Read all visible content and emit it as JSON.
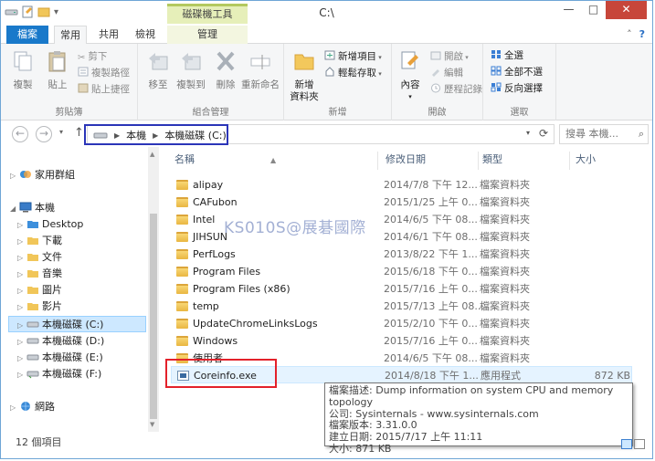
{
  "window": {
    "title": "C:\\",
    "minimize_glyph": "—",
    "maximize_glyph": "□",
    "close_glyph": "✕",
    "qat_dropdown": "▾"
  },
  "ribbon_tabs": {
    "file": "檔案",
    "home": "常用",
    "share": "共用",
    "view": "檢視",
    "context_header": "磁碟機工具",
    "manage": "管理",
    "collapse_glyph": "˄",
    "help_glyph": "?"
  },
  "ribbon": {
    "clipboard": {
      "label": "剪貼簿",
      "copy": "複製",
      "paste": "貼上",
      "cut": "剪下",
      "copy_path": "複製路徑",
      "paste_shortcut": "貼上捷徑"
    },
    "organize": {
      "label": "組合管理",
      "move_to": "移至",
      "copy_to": "複製到",
      "delete": "刪除",
      "rename": "重新命名"
    },
    "new": {
      "label": "新增",
      "new_folder": "新增\n資料夾",
      "new_item": "新增項目",
      "easy_access": "輕鬆存取"
    },
    "open": {
      "label": "開啟",
      "properties": "內容",
      "open": "開啟",
      "edit": "編輯",
      "history": "歷程記錄"
    },
    "select": {
      "label": "選取",
      "select_all": "全選",
      "select_none": "全部不選",
      "invert": "反向選擇"
    }
  },
  "addressbar": {
    "back_glyph": "←",
    "forward_glyph": "→",
    "recent_glyph": "▾",
    "up_glyph": "↑",
    "crumbs": [
      "本機",
      "本機磁碟 (C:)"
    ],
    "crumb_sep": "▶",
    "dropdown_glyph": "▾",
    "refresh_glyph": "⟳",
    "search_placeholder": "搜尋 本機...",
    "search_glyph": "⌕"
  },
  "nav": {
    "arrow_collapsed": "▷",
    "arrow_expanded": "◢",
    "items": [
      {
        "label": "家用群組"
      },
      {
        "label": "本機"
      },
      {
        "label": "Desktop"
      },
      {
        "label": "下載"
      },
      {
        "label": "文件"
      },
      {
        "label": "音樂"
      },
      {
        "label": "圖片"
      },
      {
        "label": "影片"
      },
      {
        "label": "本機磁碟 (C:)"
      },
      {
        "label": "本機磁碟 (D:)"
      },
      {
        "label": "本機磁碟 (E:)"
      },
      {
        "label": "本機磁碟 (F:)"
      },
      {
        "label": "網路"
      }
    ],
    "scroll_up": "▲",
    "scroll_down": "▼"
  },
  "filelist": {
    "columns": {
      "name": "名稱",
      "date": "修改日期",
      "type": "類型",
      "size": "大小",
      "sort_glyph": "▲"
    },
    "rows": [
      {
        "name": "alipay",
        "date": "2014/7/8 下午 12...",
        "type": "檔案資料夾",
        "size": ""
      },
      {
        "name": "CAFubon",
        "date": "2015/1/25 上午 0...",
        "type": "檔案資料夾",
        "size": ""
      },
      {
        "name": "Intel",
        "date": "2014/6/5 下午 08...",
        "type": "檔案資料夾",
        "size": ""
      },
      {
        "name": "JIHSUN",
        "date": "2014/6/1 下午 08...",
        "type": "檔案資料夾",
        "size": ""
      },
      {
        "name": "PerfLogs",
        "date": "2013/8/22 下午 1...",
        "type": "檔案資料夾",
        "size": ""
      },
      {
        "name": "Program Files",
        "date": "2015/6/18 下午 0...",
        "type": "檔案資料夾",
        "size": ""
      },
      {
        "name": "Program Files (x86)",
        "date": "2015/7/16 上午 0...",
        "type": "檔案資料夾",
        "size": ""
      },
      {
        "name": "temp",
        "date": "2015/7/13 上午 08...",
        "type": "檔案資料夾",
        "size": ""
      },
      {
        "name": "UpdateChromeLinksLogs",
        "date": "2015/2/10 下午 0...",
        "type": "檔案資料夾",
        "size": ""
      },
      {
        "name": "Windows",
        "date": "2015/7/16 上午 0...",
        "type": "檔案資料夾",
        "size": ""
      },
      {
        "name": "使用者",
        "date": "2014/6/5 下午 08...",
        "type": "檔案資料夾",
        "size": ""
      },
      {
        "name": "Coreinfo.exe",
        "date": "2014/8/18 下午 1...",
        "type": "應用程式",
        "size": "872 KB"
      }
    ]
  },
  "tooltip": {
    "line1": "檔案描述: Dump information on system CPU and memory topology",
    "line2": "公司: Sysinternals - www.sysinternals.com",
    "line3": "檔案版本: 3.31.0.0",
    "line4": "建立日期: 2015/7/17 上午 11:11",
    "line5": "大小: 871 KB"
  },
  "watermark": "KS010S@展碁國際",
  "status": {
    "count": "12 個項目"
  }
}
